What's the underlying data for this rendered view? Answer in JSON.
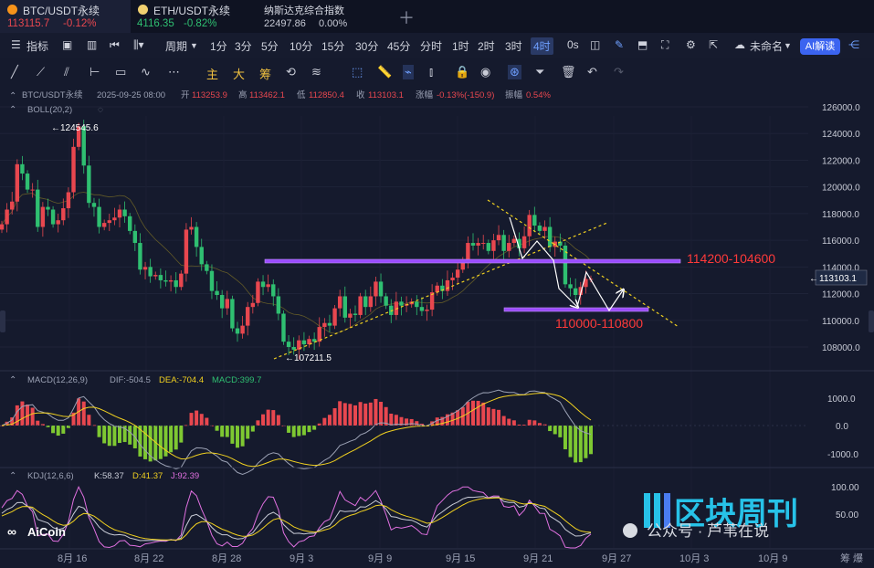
{
  "tabs": [
    {
      "name": "BTC/USDT永续",
      "price": "113115.7",
      "change": "-0.12%",
      "icon_color": "#f7931a",
      "price_color": "#e8474f"
    },
    {
      "name": "ETH/USDT永续",
      "price": "4116.35",
      "change": "-0.82%",
      "icon_color": "#f0d070",
      "price_color": "#2fbf71"
    },
    {
      "name": "纳斯达克综合指数",
      "price": "22497.86",
      "change": "0.00%"
    }
  ],
  "toolbar": {
    "indicators": "指标",
    "period": "周期",
    "intervals": [
      "1分",
      "3分",
      "5分",
      "10分",
      "15分",
      "30分",
      "45分",
      "分时",
      "1时",
      "2时",
      "3时",
      "4时"
    ],
    "active_interval": "4时",
    "zero_s": "0s",
    "unnamed": "未命名",
    "ai": "AI解读"
  },
  "draw_tools": {
    "main": "主",
    "big": "大",
    "chip": "筹"
  },
  "ohlc": {
    "pair": "BTC/USDT永续",
    "date": "2025-09-25 08:00",
    "open_label": "开",
    "open": "113253.9",
    "high_label": "高",
    "high": "113462.1",
    "low_label": "低",
    "low": "112850.4",
    "close_label": "收",
    "close": "113103.1",
    "chg_label": "涨幅",
    "chg": "-0.13%(-150.9)",
    "amp_label": "振幅",
    "amp": "0.54%"
  },
  "boll": "BOLL(20,2)",
  "macd": {
    "name": "MACD(12,26,9)",
    "dif": "DIF:-504.5",
    "dea": "DEA:-704.4",
    "macd": "MACD:399.7",
    "ticks": [
      "1000.0",
      "0.0",
      "-1000.0"
    ]
  },
  "kdj": {
    "name": "KDJ(12,6,6)",
    "k": "K:58.37",
    "d": "D:41.37",
    "j": "J:92.39",
    "ticks": [
      "100.00",
      "50.00"
    ]
  },
  "annotations": {
    "high": "124545.6",
    "low": "107211.5",
    "resistance": "114200-104600",
    "support": "110000-110800",
    "current": "113103.1"
  },
  "y_ticks": [
    "126000.0",
    "124000.0",
    "122000.0",
    "120000.0",
    "118000.0",
    "116000.0",
    "114000.0",
    "112000.0",
    "110000.0",
    "108000.0"
  ],
  "x_ticks": [
    "8月 16",
    "8月 22",
    "8月 28",
    "9月 3",
    "9月 9",
    "9月 15",
    "9月 21",
    "9月 27",
    "10月 3",
    "10月 9"
  ],
  "watermark": {
    "logo": "AiCoin",
    "brand": "区块周刊",
    "wechat": "公众号 · 芦苇在说"
  },
  "corner": "筹 爆",
  "colors": {
    "up": "#e8474f",
    "down": "#2fbf71",
    "accent": "#3b64f0",
    "purple": "#9a4bff"
  },
  "chart_data": {
    "type": "candlestick",
    "timeframe": "4h",
    "close": [
      117200,
      118300,
      118900,
      121700,
      121000,
      119800,
      119800,
      117000,
      118500,
      118300,
      117200,
      117500,
      118400,
      119600,
      123000,
      124545.6,
      121600,
      118800,
      118500,
      117000,
      117300,
      117500,
      117700,
      118300,
      117800,
      116700,
      115800,
      113800,
      114000,
      113300,
      113400,
      113000,
      112900,
      113000,
      112500,
      113500,
      116800,
      117000,
      115500,
      114200,
      113700,
      112200,
      111900,
      110900,
      111600,
      109400,
      109000,
      109600,
      111000,
      111300,
      112900,
      112500,
      112700,
      111800,
      110500,
      108400,
      108000,
      107800,
      108500,
      108200,
      108600,
      108400,
      109500,
      109800,
      109600,
      110900,
      111800,
      110200,
      110500,
      110400,
      111800,
      111000,
      111800,
      112900,
      111800,
      111100,
      110400,
      111400,
      111100,
      111200,
      111400,
      111000,
      110700,
      110800,
      112100,
      112600,
      112200,
      113000,
      113200,
      113800,
      114500,
      115800,
      115600,
      115800,
      115800,
      115200,
      116000,
      116400,
      115200,
      115800,
      116100,
      115400,
      116300,
      117900,
      117100,
      116700,
      117000,
      115500,
      115900,
      115600,
      112700,
      112400,
      111900,
      112500,
      113100,
      113103.1
    ],
    "y_range": [
      107000,
      127000
    ],
    "x_range": [
      "8月 10",
      "10月 12"
    ],
    "lines": [
      {
        "name": "resistance",
        "label": "114200-104600",
        "value": 114400,
        "color": "#9a4bff"
      },
      {
        "name": "support",
        "label": "110000-110800",
        "value": 110800,
        "color": "#9a4bff"
      }
    ],
    "macd": {
      "dif": -504.5,
      "dea": -704.4,
      "hist": 399.7
    },
    "kdj": {
      "k": 58.37,
      "d": 41.37,
      "j": 92.39
    }
  }
}
